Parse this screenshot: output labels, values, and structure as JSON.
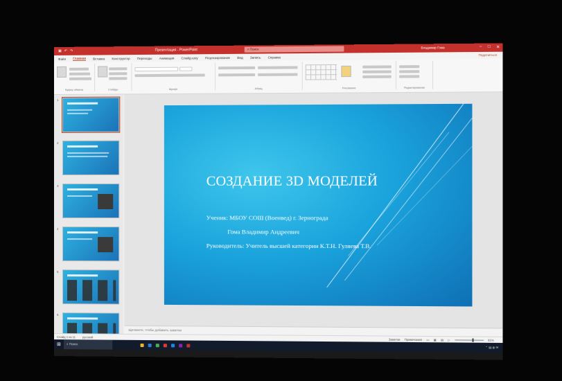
{
  "window": {
    "title": "Презентация - PowerPoint",
    "search_placeholder": "Поиск",
    "user": "Владимир Гома",
    "share": "Поделиться"
  },
  "ribbon_tabs": [
    "Файл",
    "Главная",
    "Вставка",
    "Конструктор",
    "Переходы",
    "Анимация",
    "Слайд-шоу",
    "Рецензирование",
    "Вид",
    "Запись",
    "Справка"
  ],
  "active_tab": "Главная",
  "ribbon_groups": [
    "Буфер обмена",
    "Слайды",
    "Шрифт",
    "Абзац",
    "Рисование",
    "Редактирование"
  ],
  "thumbnails": [
    {
      "num": "1",
      "selected": true
    },
    {
      "num": "2",
      "selected": false
    },
    {
      "num": "3",
      "selected": false
    },
    {
      "num": "4",
      "selected": false
    },
    {
      "num": "5",
      "selected": false
    },
    {
      "num": "6",
      "selected": false
    }
  ],
  "slide": {
    "title": "СОЗДАНИЕ 3D МОДЕЛЕЙ",
    "student_line": "Ученик: МБОУ СОШ (Военвед) г. Зернограда",
    "name_line": "Гома Владимир Андреевич",
    "lead_line": "Руководитель: Учитель высшей категории К.Т.Н. Гуляева Т.В."
  },
  "notes_placeholder": "Щелкните, чтобы добавить заметки",
  "status": {
    "slide_counter": "Слайд 1 из 11",
    "language": "русский",
    "notes": "Заметки",
    "comments": "Примечания",
    "zoom": "91%"
  },
  "taskbar": {
    "search": "Поиск"
  },
  "colors": {
    "titlebar": "#c4312c",
    "slide_bg": "#1aa3dc",
    "accent": "#b7472a"
  }
}
